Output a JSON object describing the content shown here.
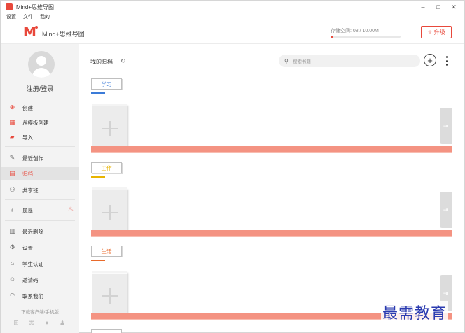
{
  "window": {
    "title": "Mind+思维导图",
    "controls": [
      "–",
      "□",
      "✕"
    ]
  },
  "menu": [
    "设置",
    "文件",
    "我的"
  ],
  "header": {
    "logo_letter": "M",
    "logo_text": "Mind+思维导图",
    "storage_label": "存储空间: 08 / 10.00M",
    "storage_fraction": 0.04,
    "upgrade_label": "升级"
  },
  "sidebar": {
    "login": "注册/登录",
    "items": [
      {
        "label": "创建",
        "icon": "plus-circle-icon"
      },
      {
        "label": "从模板创建",
        "icon": "template-grid-icon"
      },
      {
        "label": "导入",
        "icon": "folder-import-icon"
      },
      {
        "label": "最近创作",
        "icon": "pencil-icon"
      },
      {
        "label": "归档",
        "icon": "archive-icon",
        "active": true
      },
      {
        "label": "共享班",
        "icon": "share-group-icon"
      },
      {
        "label": "风暴",
        "icon": "lightbulb-icon"
      },
      {
        "label": "最近删除",
        "icon": "trash-icon"
      },
      {
        "label": "设置",
        "icon": "gear-icon"
      },
      {
        "label": "学生认证",
        "icon": "graduation-cap-icon"
      },
      {
        "label": "邀请码",
        "icon": "user-icon"
      },
      {
        "label": "联系我们",
        "icon": "headset-icon"
      }
    ],
    "download_text": "下载客户端/手机版",
    "os_icons": [
      "windows-icon",
      "mac-icon",
      "apple-icon",
      "android-icon"
    ]
  },
  "main": {
    "title": "我的归档",
    "search_placeholder": "搜索书籍",
    "shelves": [
      {
        "tag": "学习",
        "color": "#3b7bd8"
      },
      {
        "tag": "工作",
        "color": "#e8b400"
      },
      {
        "tag": "生活",
        "color": "#e86a2b"
      }
    ]
  },
  "watermark": "最需教育",
  "colors": {
    "accent": "#e8483b",
    "shelf": "#f49382"
  }
}
